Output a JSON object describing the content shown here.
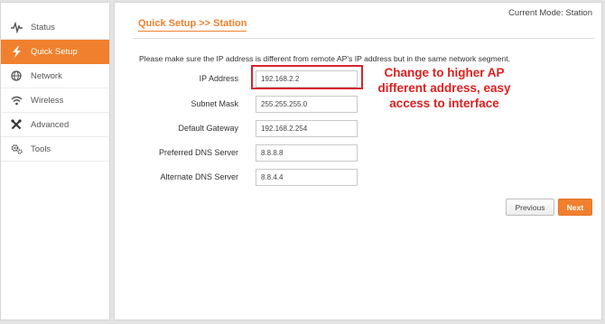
{
  "nav": {
    "items": [
      {
        "label": "Status",
        "icon": "pulse-icon"
      },
      {
        "label": "Quick Setup",
        "icon": "lightning-icon"
      },
      {
        "label": "Network",
        "icon": "globe-icon"
      },
      {
        "label": "Wireless",
        "icon": "wifi-icon"
      },
      {
        "label": "Advanced",
        "icon": "tools-cross-icon"
      },
      {
        "label": "Tools",
        "icon": "gears-icon"
      }
    ],
    "active_index": 1
  },
  "header": {
    "mode": "Current Mode: Station",
    "title": "Quick Setup >> Station"
  },
  "notice": "Please make sure the IP address is different from remote AP's IP address but in the same network segment.",
  "form": {
    "ip_address": {
      "label": "IP Address",
      "value": "192.168.2.2"
    },
    "subnet_mask": {
      "label": "Subnet Mask",
      "value": "255.255.255.0"
    },
    "default_gateway": {
      "label": "Default Gateway",
      "value": "192.168.2.254"
    },
    "preferred_dns": {
      "label": "Preferred DNS Server",
      "value": "8.8.8.8"
    },
    "alternate_dns": {
      "label": "Alternate DNS Server",
      "value": "8.8.4.4"
    }
  },
  "annotation": {
    "line1": "Change to higher AP",
    "line2": "different address, easy",
    "line3": "access to interface",
    "color": "#e01e1e"
  },
  "buttons": {
    "previous": "Previous",
    "next": "Next"
  },
  "colors": {
    "accent": "#f0802d",
    "highlight_border": "#d4242e"
  }
}
